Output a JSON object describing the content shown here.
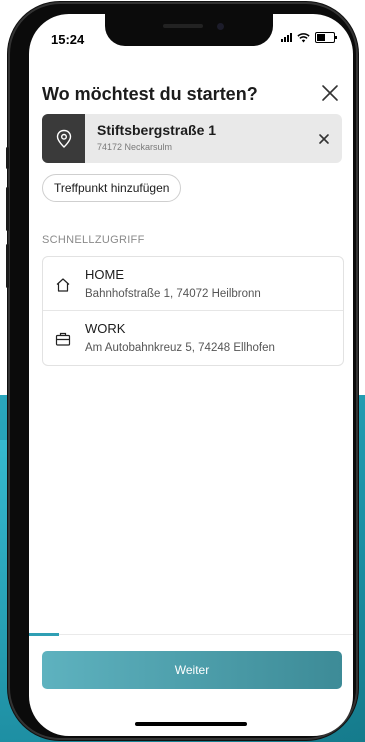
{
  "status": {
    "time": "15:24"
  },
  "header": {
    "title": "Wo möchtest du starten?",
    "close_icon": "close-icon"
  },
  "start_location": {
    "name": "Stiftsbergstraße 1",
    "subtitle": "74172 Neckarsulm",
    "icon": "location-pin-icon",
    "clear_icon": "close-icon"
  },
  "meeting_point_button": {
    "label": "Treffpunkt hinzufügen"
  },
  "quick_access": {
    "title": "SCHNELLZUGRIFF",
    "items": [
      {
        "label": "HOME",
        "address": "Bahnhofstraße 1, 74072 Heilbronn",
        "icon": "house-icon"
      },
      {
        "label": "WORK",
        "address": "Am Autobahnkreuz 5, 74248 Ellhofen",
        "icon": "briefcase-icon"
      }
    ]
  },
  "progress": {
    "fraction": 0.1
  },
  "footer": {
    "continue_label": "Weiter"
  },
  "colors": {
    "accent": "#2f9fb4",
    "button_gradient_start": "#5eb2bf",
    "button_gradient_end": "#3d8b97",
    "background_teal": "#1b8fa3"
  }
}
